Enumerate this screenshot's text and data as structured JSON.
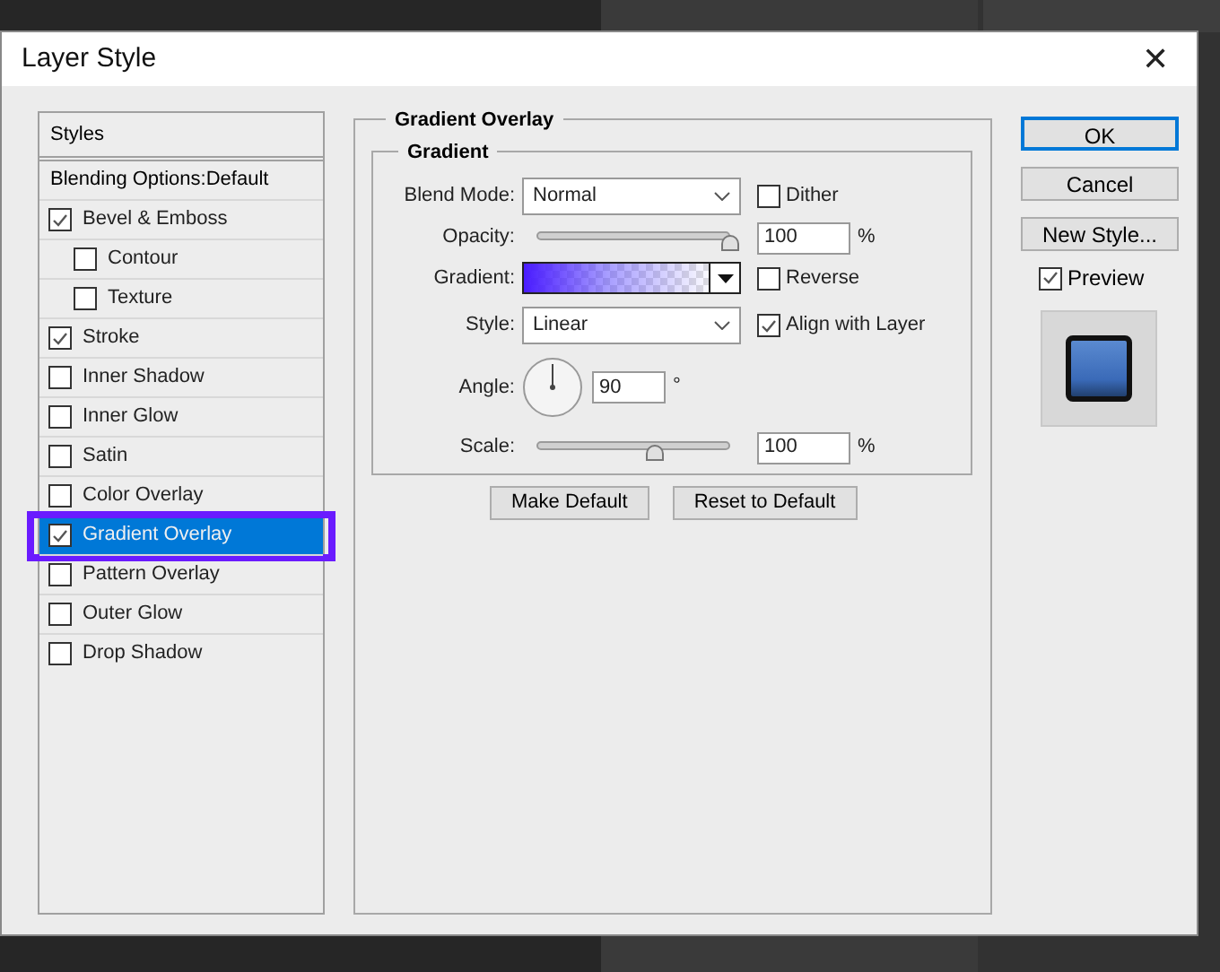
{
  "window": {
    "title": "Layer Style",
    "close": "✕"
  },
  "sidebar": {
    "header": "Styles",
    "blending": "Blending Options:Default",
    "items": [
      {
        "label": "Bevel & Emboss",
        "checked": true,
        "selected": false,
        "highlighted": false,
        "children": [
          {
            "label": "Contour",
            "checked": false,
            "selected": false,
            "highlighted": false
          },
          {
            "label": "Texture",
            "checked": false,
            "selected": false,
            "highlighted": false
          }
        ]
      },
      {
        "label": "Stroke",
        "checked": true,
        "selected": false,
        "highlighted": false
      },
      {
        "label": "Inner Shadow",
        "checked": false,
        "selected": false,
        "highlighted": false
      },
      {
        "label": "Inner Glow",
        "checked": false,
        "selected": false,
        "highlighted": false
      },
      {
        "label": "Satin",
        "checked": false,
        "selected": false,
        "highlighted": false
      },
      {
        "label": "Color Overlay",
        "checked": false,
        "selected": false,
        "highlighted": false
      },
      {
        "label": "Gradient Overlay",
        "checked": true,
        "selected": true,
        "highlighted": true
      },
      {
        "label": "Pattern Overlay",
        "checked": false,
        "selected": false,
        "highlighted": false
      },
      {
        "label": "Outer Glow",
        "checked": false,
        "selected": false,
        "highlighted": false
      },
      {
        "label": "Drop Shadow",
        "checked": false,
        "selected": false,
        "highlighted": false
      }
    ]
  },
  "panel": {
    "title": "Gradient Overlay",
    "group": "Gradient",
    "blend_mode": {
      "label": "Blend Mode:",
      "value": "Normal"
    },
    "dither": {
      "label": "Dither",
      "checked": false
    },
    "opacity": {
      "label": "Opacity:",
      "level": 1,
      "value": "100",
      "unit": "%"
    },
    "gradient": {
      "label": "Gradient:"
    },
    "reverse": {
      "label": "Reverse",
      "checked": false
    },
    "style": {
      "label": "Style:",
      "value": "Linear"
    },
    "align": {
      "label": "Align with Layer",
      "checked": true
    },
    "angle": {
      "label": "Angle:",
      "value": "90",
      "unit": "°"
    },
    "scale": {
      "label": "Scale:",
      "level": 0.61,
      "value": "100",
      "unit": "%"
    },
    "buttons": [
      "Make Default",
      "Reset to Default"
    ]
  },
  "actions": [
    {
      "label": "OK",
      "default": true
    },
    {
      "label": "Cancel",
      "default": false
    },
    {
      "label": "New Style...",
      "default": false
    }
  ],
  "preview": {
    "label": "Preview",
    "checked": true
  }
}
